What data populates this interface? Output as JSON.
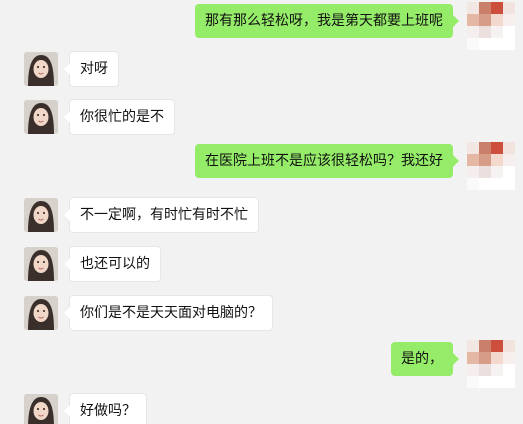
{
  "conversation": {
    "messages": [
      {
        "side": "right",
        "text": "那有那么轻松呀，我是第天都要上班呢"
      },
      {
        "side": "left",
        "text": "对呀"
      },
      {
        "side": "left",
        "text": "你很忙的是不"
      },
      {
        "side": "right",
        "text": "在医院上班不是应该很轻松吗？我还好"
      },
      {
        "side": "left",
        "text": "不一定啊，有时忙有时不忙"
      },
      {
        "side": "left",
        "text": "也还可以的"
      },
      {
        "side": "left",
        "text": "你们是不是天天面对电脑的？"
      },
      {
        "side": "right",
        "text": "是的，"
      },
      {
        "side": "left",
        "text": "好做吗？"
      }
    ]
  },
  "colors": {
    "background": "#f2f2f2",
    "sent_bubble": "#95ec69",
    "received_bubble": "#ffffff"
  },
  "icons": {
    "left_avatar": "contact-portrait-icon",
    "right_avatar": "pixelated-self-avatar-icon"
  }
}
